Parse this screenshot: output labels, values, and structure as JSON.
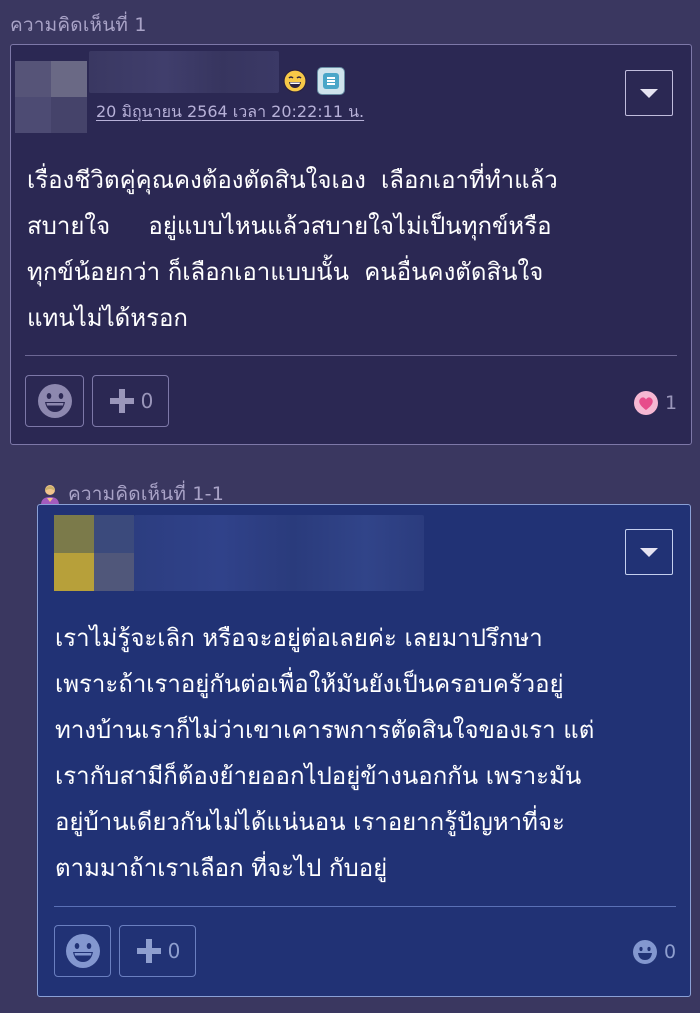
{
  "comments": [
    {
      "label": "ความคิดเห็นที่ 1",
      "timestamp": "20 มิถุนายน 2564 เวลา 20:22:11 น.",
      "body": "เรื่องชีวิตคู่คุณคงต้องตัดสินใจเอง  เลือกเอาที่ทำแล้ว\nสบายใจ     อยู่แบบไหนแล้วสบายใจไม่เป็นทุกข์หรือ\nทุกข์น้อยกว่า ก็เลือกเอาแบบนั้น  คนอื่นคงตัดสินใจ\nแทนไม่ได้หรอก",
      "plus_count": "0",
      "reaction_icon": "heart-icon",
      "reaction_count": "1",
      "colors": {
        "card_bg": "#2b2853",
        "reaction": "#e74c8b"
      }
    },
    {
      "label": "ความคิดเห็นที่ 1-1",
      "body": "เราไม่รู้จะเลิก หรือจะอยู่ต่อเลยค่ะ เลยมาปรึกษา\nเพราะถ้าเราอยู่กันต่อเพื่อให้มันยังเป็นครอบครัวอยู่\nทางบ้านเราก็ไม่ว่าเขาเคารพการตัดสินใจของเรา แต่\nเรากับสามีก็ต้องย้ายออกไปอยู่ข้างนอกกัน เพราะมัน\nอยู่บ้านเดียวกันไม่ได้แน่นอน เราอยากรู้ปัญหาที่จะ\nตามมาถ้าเราเลือก ที่จะไป กับอยู่",
      "plus_count": "0",
      "reaction_icon": "smile-reaction-icon",
      "reaction_count": "0",
      "colors": {
        "card_bg": "#213275"
      }
    }
  ],
  "theme": {
    "page_bg": "#3a3760",
    "label_color": "#a9a3c7"
  }
}
